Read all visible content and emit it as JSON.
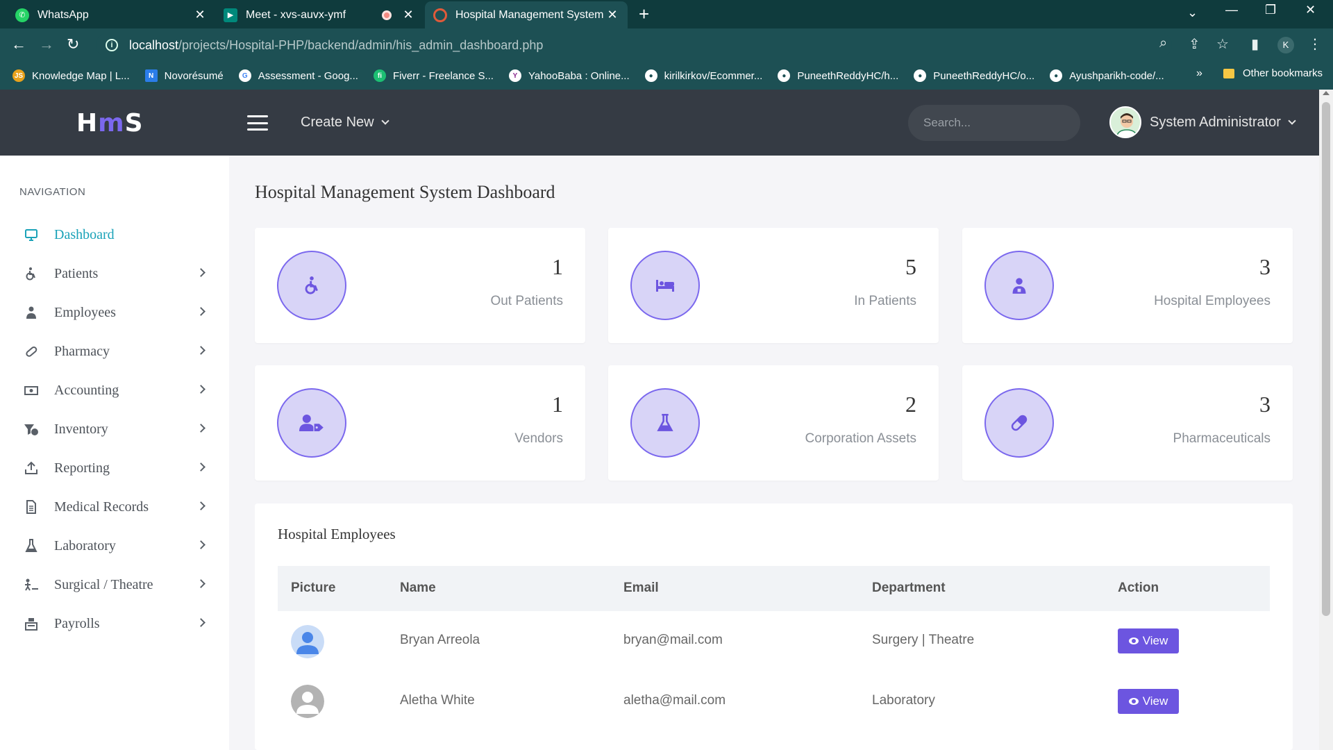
{
  "browser": {
    "tabs": [
      {
        "title": "WhatsApp"
      },
      {
        "title": "Meet - xvs-auvx-ymf"
      },
      {
        "title": "Hospital Management System -A"
      }
    ],
    "address": {
      "host": "localhost",
      "path": "/projects/Hospital-PHP/backend/admin/his_admin_dashboard.php"
    },
    "profile_initial": "K",
    "bookmarks": [
      {
        "label": "Knowledge Map | L...",
        "icon": "js-icon",
        "color": "#e8a21c",
        "glyph": "JS"
      },
      {
        "label": "Novorésumé",
        "icon": "novoresume-icon",
        "color": "#2b7de9",
        "glyph": "N"
      },
      {
        "label": "Assessment - Goog...",
        "icon": "google-icon",
        "color": "#ffffff",
        "glyph": "G"
      },
      {
        "label": "Fiverr - Freelance S...",
        "icon": "fiverr-icon",
        "color": "#1dbf73",
        "glyph": "fi"
      },
      {
        "label": "YahooBaba : Online...",
        "icon": "yahoobaba-icon",
        "color": "#8b2b8f",
        "glyph": "Y"
      },
      {
        "label": "kirilkirkov/Ecommer...",
        "icon": "github-icon",
        "color": "#ffffff",
        "glyph": ""
      },
      {
        "label": "PuneethReddyHC/h...",
        "icon": "github-icon",
        "color": "#ffffff",
        "glyph": ""
      },
      {
        "label": "PuneethReddyHC/o...",
        "icon": "github-icon",
        "color": "#ffffff",
        "glyph": ""
      },
      {
        "label": "Ayushparikh-code/...",
        "icon": "github-icon",
        "color": "#ffffff",
        "glyph": ""
      }
    ],
    "bookmarks_more": "»",
    "other_bookmarks": "Other bookmarks"
  },
  "header": {
    "logo_left": "H",
    "logo_mid": "m",
    "logo_right": "S",
    "create_new": "Create New",
    "search_placeholder": "Search...",
    "user_name": "System Administrator"
  },
  "sidebar": {
    "title": "NAVIGATION",
    "items": [
      {
        "label": "Dashboard",
        "icon": "monitor-icon",
        "active": true
      },
      {
        "label": "Patients",
        "icon": "wheelchair-icon"
      },
      {
        "label": "Employees",
        "icon": "user-tie-icon"
      },
      {
        "label": "Pharmacy",
        "icon": "pill-icon"
      },
      {
        "label": "Accounting",
        "icon": "money-icon"
      },
      {
        "label": "Inventory",
        "icon": "inventory-icon"
      },
      {
        "label": "Reporting",
        "icon": "upload-icon"
      },
      {
        "label": "Medical Records",
        "icon": "file-icon"
      },
      {
        "label": "Laboratory",
        "icon": "flask-icon"
      },
      {
        "label": "Surgical / Theatre",
        "icon": "surgery-icon"
      },
      {
        "label": "Payrolls",
        "icon": "cash-register-icon"
      }
    ]
  },
  "page_title": "Hospital Management System Dashboard",
  "stats": [
    {
      "value": "1",
      "label": "Out Patients",
      "icon": "wheelchair-icon"
    },
    {
      "value": "5",
      "label": "In Patients",
      "icon": "bed-icon"
    },
    {
      "value": "3",
      "label": "Hospital Employees",
      "icon": "user-nurse-icon"
    },
    {
      "value": "1",
      "label": "Vendors",
      "icon": "user-tag-icon"
    },
    {
      "value": "2",
      "label": "Corporation Assets",
      "icon": "flask-icon"
    },
    {
      "value": "3",
      "label": "Pharmaceuticals",
      "icon": "capsule-icon"
    }
  ],
  "employees": {
    "title": "Hospital Employees",
    "columns": [
      "Picture",
      "Name",
      "Email",
      "Department",
      "Action"
    ],
    "rows": [
      {
        "name": "Bryan Arreola",
        "email": "bryan@mail.com",
        "department": "Surgery | Theatre",
        "action": "View",
        "avatar": "blue"
      },
      {
        "name": "Aletha White",
        "email": "aletha@mail.com",
        "department": "Laboratory",
        "action": "View",
        "avatar": "gray"
      }
    ]
  },
  "colors": {
    "accent": "#7b68ee",
    "active_nav": "#1aa2b8",
    "header_bg": "#353b44",
    "button": "#6c55e0"
  }
}
